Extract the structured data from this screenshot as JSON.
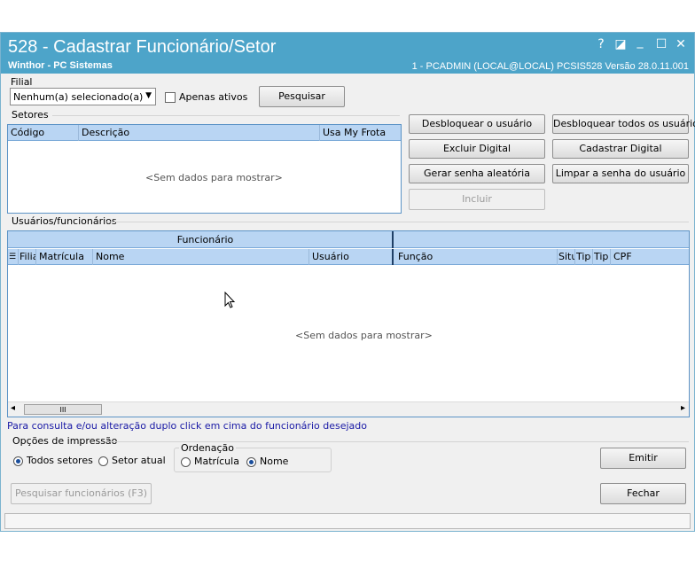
{
  "window": {
    "title": "528 - Cadastrar Funcionário/Setor",
    "subtitle": "Winthor - PC Sistemas",
    "status": "1 - PCADMIN (LOCAL@LOCAL)   PCSIS528  Versão  28.0.11.001",
    "help_glyph": "?",
    "maximize2_glyph": "◪",
    "minimize_glyph": "_",
    "maximize_glyph": "☐",
    "close_glyph": "✕"
  },
  "filial": {
    "label": "Filial",
    "select_value": "Nenhum(a) selecionado(a)",
    "apenas_ativos": "Apenas ativos",
    "pesquisar": "Pesquisar"
  },
  "setores": {
    "label": "Setores",
    "columns": [
      "Código",
      "Descrição",
      "Usa My Frota"
    ],
    "empty": "<Sem dados para mostrar>"
  },
  "actions": {
    "desbloquear_usuario": "Desbloquear o usuário",
    "desbloquear_todos": "Desbloquear todos os usuários",
    "excluir_digital": "Excluir Digital",
    "cadastrar_digital": "Cadastrar Digital",
    "gerar_senha": "Gerar senha aleatória",
    "limpar_senha": "Limpar a senha do usuário",
    "incluir": "Incluir"
  },
  "usuarios": {
    "label": "Usuários/funcionários",
    "band": "Funcionário",
    "columns": [
      "Filia",
      "Matrícula",
      "Nome",
      "Usuário",
      "Função",
      "Situ",
      "Tip",
      "Tip",
      "CPF"
    ],
    "empty": "<Sem dados para mostrar>",
    "scroll_left": "◂",
    "scroll_right": "▸",
    "scroll_thumb": "III"
  },
  "hint": "Para consulta e/ou alteração duplo click em cima do funcionário desejado",
  "impressao": {
    "label": "Opções de impressão",
    "todos_setores": "Todos setores",
    "setor_atual": "Setor atual",
    "ordenacao_label": "Ordenação",
    "matricula": "Matrícula",
    "nome": "Nome"
  },
  "buttons": {
    "emitir": "Emitir",
    "pesquisar_funcionarios": "Pesquisar funcionários (F3)",
    "fechar": "Fechar"
  },
  "colors": {
    "titlebar": "#4da4c9",
    "grid_header": "#b9d5f3",
    "hint_text": "#1a1aa6"
  }
}
